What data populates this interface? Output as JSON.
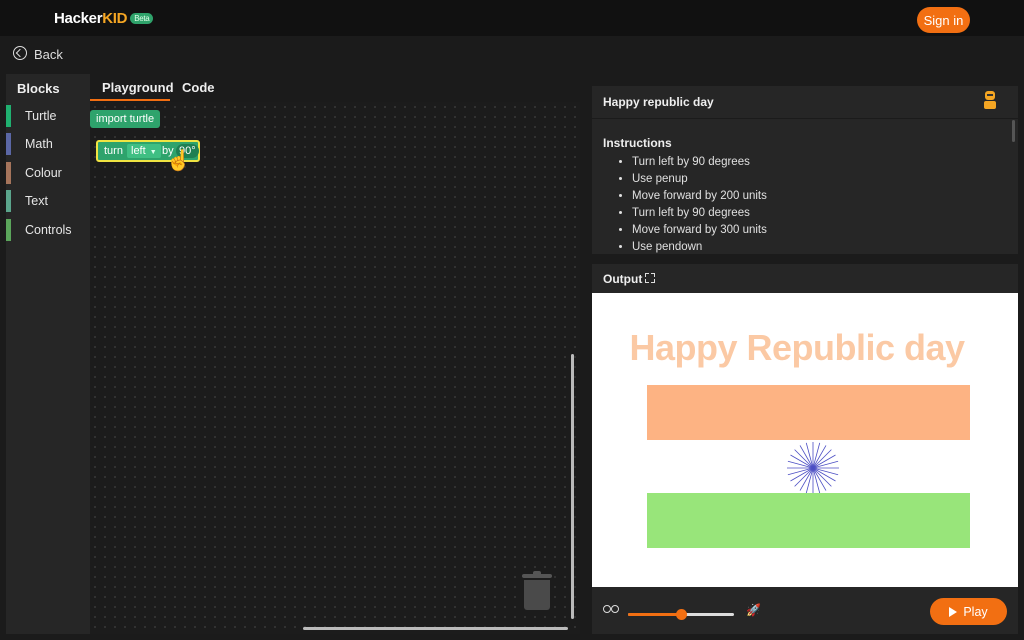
{
  "header": {
    "logo_hacker": "Hacker",
    "logo_kid": "KID",
    "logo_badge": "Beta",
    "signin_label": "Sign in"
  },
  "back": {
    "label": "Back"
  },
  "blocks_panel": {
    "title": "Blocks",
    "categories": [
      {
        "label": "Turtle",
        "color": "#20b070"
      },
      {
        "label": "Math",
        "color": "#5b67a5"
      },
      {
        "label": "Colour",
        "color": "#a5745b"
      },
      {
        "label": "Text",
        "color": "#5ba58c"
      },
      {
        "label": "Controls",
        "color": "#5ba55b"
      }
    ]
  },
  "tabs": [
    {
      "label": "Playground",
      "active": true
    },
    {
      "label": "Code",
      "active": false
    }
  ],
  "workspace": {
    "import_block": "import turtle",
    "turn_block": {
      "word": "turn",
      "direction": "left",
      "by": "by",
      "angle": "90°"
    }
  },
  "instructions": {
    "title": "Happy republic day",
    "heading": "Instructions",
    "items": [
      "Turn left by 90 degrees",
      "Use penup",
      "Move forward by 200 units",
      "Turn left by 90 degrees",
      "Move forward by 300 units",
      "Use pendown"
    ]
  },
  "output": {
    "title": "Output",
    "canvas_text": "Happy Republic day",
    "flag_colors": {
      "top": "#fdb383",
      "middle": "#ffffff",
      "bottom": "#98e57a",
      "chakra": "#4b4ec4"
    }
  },
  "controls": {
    "speed_fraction": 0.5,
    "play_label": "Play"
  },
  "colors": {
    "accent": "#f26f12",
    "block_green": "#2ea36c"
  }
}
